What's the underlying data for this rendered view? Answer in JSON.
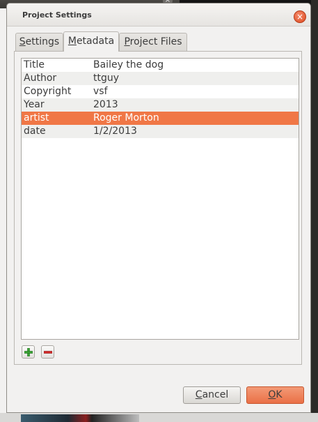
{
  "dialog": {
    "title": "Project Settings"
  },
  "tabs": [
    {
      "pre": "",
      "u": "S",
      "post": "ettings"
    },
    {
      "pre": "",
      "u": "M",
      "post": "etadata"
    },
    {
      "pre": "",
      "u": "P",
      "post": "roject Files"
    }
  ],
  "active_tab": "Metadata",
  "metadata": [
    {
      "key": "Title",
      "value": "Bailey the dog"
    },
    {
      "key": "Author",
      "value": "ttguy"
    },
    {
      "key": "Copyright",
      "value": "vsf"
    },
    {
      "key": "Year",
      "value": "2013"
    },
    {
      "key": "artist",
      "value": "Roger Morton",
      "selected": true
    },
    {
      "key": "date",
      "value": "1/2/2013"
    }
  ],
  "buttons": {
    "cancel": {
      "u": "C",
      "post": "ancel"
    },
    "ok": {
      "u": "O",
      "post": "K"
    }
  },
  "icons": {
    "add": "plus-icon",
    "remove": "minus-icon",
    "close": "close-icon"
  },
  "colors": {
    "accent": "#f07746",
    "add_green": "#3aa435",
    "remove_red": "#d42a2a"
  }
}
